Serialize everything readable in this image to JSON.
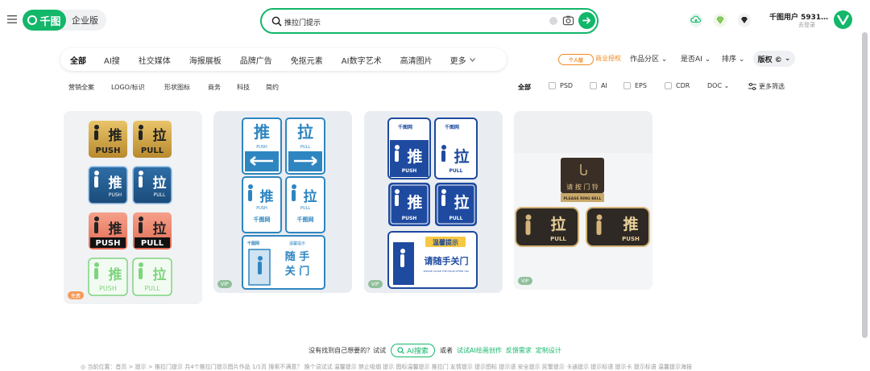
{
  "header": {
    "logo_text": "千图",
    "edition": "企业版",
    "search_value": "推拉门提示",
    "user_name": "千图用户 5931…",
    "user_sub": "去登录",
    "brand_color": "#12b76a"
  },
  "categories": [
    "全部",
    "AI搜",
    "社交媒体",
    "海报展板",
    "品牌广告",
    "免抠元素",
    "AI数字艺术",
    "高清图片",
    "更多"
  ],
  "right_filters": {
    "personal_badge": "个人版",
    "personal_text": "商业授权",
    "zone": "作品分区",
    "is_ai": "是否AI",
    "sort": "排序",
    "copyright": "版权 ©"
  },
  "sub_categories": [
    "营销全案",
    "LOGO/标识",
    "形状图标",
    "商务",
    "科技",
    "简约"
  ],
  "formats": {
    "all": "全部",
    "items": [
      "PSD",
      "AI",
      "EPS",
      "CDR"
    ],
    "doc": "DOC",
    "more_filters": "更多筛选"
  },
  "cards": {
    "c1": {
      "row1": [
        {
          "char": "推",
          "word": "PUSH"
        },
        {
          "char": "拉",
          "word": "PULL"
        }
      ],
      "row2": [
        {
          "char": "推",
          "word": "PUSH"
        },
        {
          "char": "拉",
          "word": "PULL"
        }
      ],
      "row3": [
        {
          "char": "推",
          "word": "PUSH"
        },
        {
          "char": "拉",
          "word": "PULL"
        }
      ],
      "row4": [
        {
          "char": "推",
          "word": "PUSH"
        },
        {
          "char": "拉",
          "word": "PULL"
        }
      ],
      "tag": "免费"
    },
    "c2": {
      "push": "推",
      "push_en": "PUSH",
      "pull": "拉",
      "pull_en": "PULL",
      "brand": "千图网",
      "close_line1": "随 手",
      "close_line2": "关 门",
      "close_small": "温馨提示",
      "tag": "VIP"
    },
    "c3": {
      "brand": "千图网",
      "push": "推",
      "push_en": "PUSH",
      "pull": "拉",
      "pull_en": "PULL",
      "tip": "温馨提示",
      "close": "请随手关门",
      "close_en": "PLEASE CLOSE THE DOOR AFTER YOU",
      "tag": "VIP"
    },
    "c4": {
      "bell": "请 按 门 铃",
      "bell_en": "PLEASE RING BELL",
      "pull": "拉",
      "pull_en": "PULL",
      "push": "推",
      "push_en": "PUSH",
      "tag": "VIP"
    }
  },
  "bottom": {
    "prompt": "没有找到自己想要的？试试",
    "ai_search": "AI搜索",
    "or": "或者",
    "link1": "试试AI绘画创作",
    "link2": "反馈需求",
    "link3": "定制设计",
    "crumbs": "◎ 当前位置：首页 > 提示 > 推拉门提示    共4个推拉门提示图片作品  1/1页    搜索不满意？ 换个词试试 温馨提示 禁止吸烟 提示 图标温馨提示 推拉门 友情提示 提示图标 提示语 安全提示 民警提示 卡通提示 提示标语 提示卡 提示标语 温馨提示海报"
  }
}
